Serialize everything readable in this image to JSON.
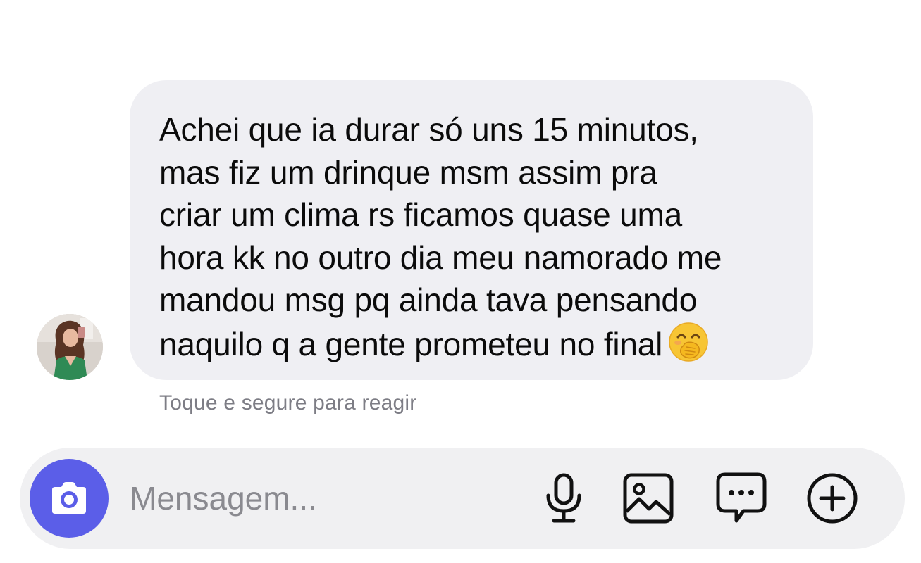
{
  "conversation": {
    "message": {
      "lines": [
        "Achei que ia durar só uns 15 minutos,",
        "mas fiz um drinque msm assim pra",
        "criar um clima rs ficamos quase uma",
        "hora kk no outro dia meu namorado me",
        "mandou msg pq ainda tava pensando",
        "naquilo q a gente prometeu no final"
      ],
      "trailing_emoji": "face-with-hand-over-mouth",
      "bubble_color": "#efeff3"
    },
    "hint": "Toque e segure para reagir"
  },
  "composer": {
    "placeholder": "Mensagem...",
    "value": "",
    "accent_color": "#5b5ee8",
    "icons": [
      "camera-icon",
      "microphone-icon",
      "image-icon",
      "chat-bubble-icon",
      "plus-circle-icon"
    ]
  }
}
